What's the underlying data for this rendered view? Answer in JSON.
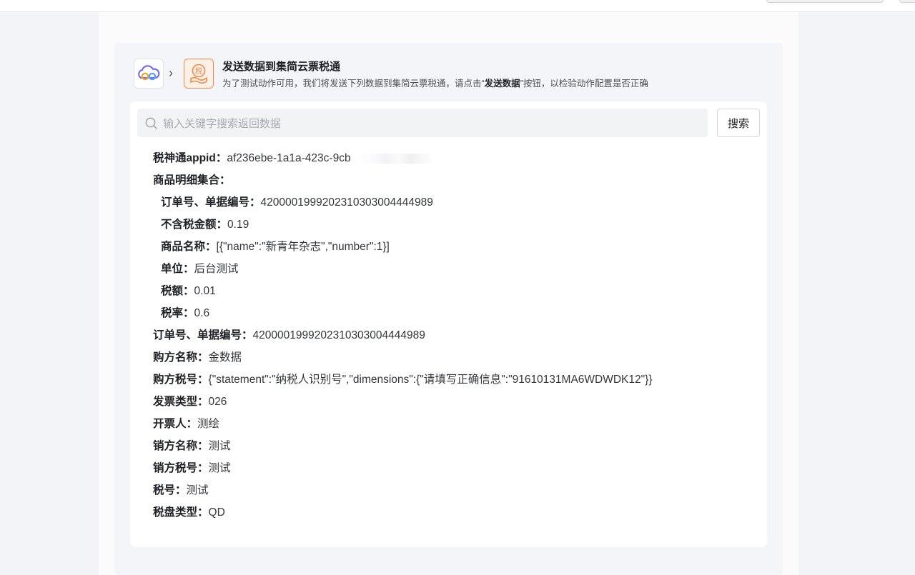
{
  "header": {
    "title": "发送数据到集简云票税通",
    "desc_prefix": "为了测试动作可用，我们将发送下列数据到集简云票税通，请点击“",
    "desc_bold": "发送数据",
    "desc_suffix": "”按钮，以检验动作配置是否正确",
    "source_icon": "jijianyun-cloud-logo",
    "target_icon": "piaoshuitong-tax-logo",
    "target_icon_char": "税",
    "accent_color": "#ef8a4a"
  },
  "search": {
    "placeholder": "输入关键字搜索返回数据",
    "button_label": "搜索"
  },
  "rows": [
    {
      "key": "税神通appid：",
      "value": "af236ebe-1a1a-423c-9cb",
      "indent": false
    },
    {
      "key": "商品明细集合：",
      "value": "",
      "indent": false
    },
    {
      "key": "订单号、单据编号：",
      "value": "420000199920231030300444498​9",
      "indent": true
    },
    {
      "key": "不含税金额：",
      "value": "0.19",
      "indent": true
    },
    {
      "key": "商品名称：",
      "value": "[{\"name\":\"新青年杂志\",\"number\":1}]",
      "indent": true
    },
    {
      "key": "单位：",
      "value": "后台测试",
      "indent": true
    },
    {
      "key": "税额：",
      "value": "0.01",
      "indent": true
    },
    {
      "key": "税率：",
      "value": "0.6",
      "indent": true
    },
    {
      "key": "订单号、单据编号：",
      "value": "4200001999202310303004444989",
      "indent": false
    },
    {
      "key": "购方名称：",
      "value": "金数据",
      "indent": false
    },
    {
      "key": "购方税号：",
      "value": "{\"statement\":\"纳税人识别号\",\"dimensions\":{\"请填写正确信息\":\"91610131MA6WDWDK12\"}}",
      "indent": false
    },
    {
      "key": "发票类型：",
      "value": "026",
      "indent": false
    },
    {
      "key": "开票人：",
      "value": "测绘",
      "indent": false
    },
    {
      "key": "销方名称：",
      "value": "测试",
      "indent": false
    },
    {
      "key": "销方税号：",
      "value": "测试",
      "indent": false
    },
    {
      "key": "税号：",
      "value": "测试",
      "indent": false
    },
    {
      "key": "税盘类型：",
      "value": "QD",
      "indent": false
    }
  ]
}
